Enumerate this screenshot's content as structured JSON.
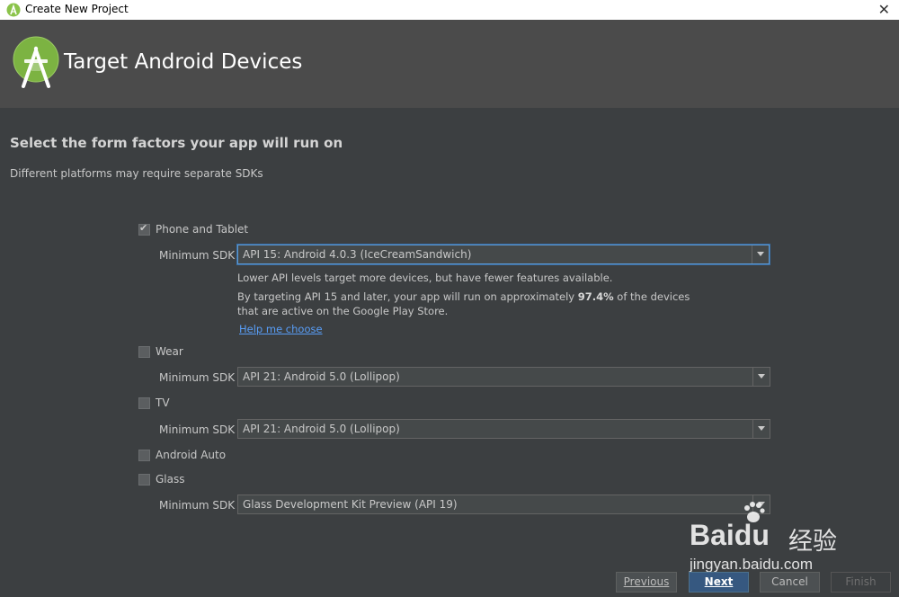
{
  "window": {
    "title": "Create New Project",
    "close_glyph": "✕"
  },
  "banner": {
    "heading": "Target Android Devices"
  },
  "page": {
    "heading": "Select the form factors your app will run on",
    "subtext": "Different platforms may require separate SDKs"
  },
  "form": {
    "min_sdk_label": "Minimum SDK",
    "phone": {
      "label": "Phone and Tablet",
      "checked": true,
      "sdk": "API 15: Android 4.0.3 (IceCreamSandwich)",
      "info1": "Lower API levels target more devices, but have fewer features available.",
      "info2_pre": "By targeting API 15 and later, your app will run on approximately ",
      "info2_bold": "97.4%",
      "info2_post": " of the devices",
      "info3": "that are active on the Google Play Store.",
      "help_link": "Help me choose"
    },
    "wear": {
      "label": "Wear",
      "checked": false,
      "sdk": "API 21: Android 5.0 (Lollipop)"
    },
    "tv": {
      "label": "TV",
      "checked": false,
      "sdk": "API 21: Android 5.0 (Lollipop)"
    },
    "auto": {
      "label": "Android Auto",
      "checked": false
    },
    "glass": {
      "label": "Glass",
      "checked": false,
      "sdk": "Glass Development Kit Preview (API 19)"
    }
  },
  "buttons": {
    "previous": "Previous",
    "next": "Next",
    "cancel": "Cancel",
    "finish": "Finish"
  },
  "watermark": {
    "brand_a": "Bai",
    "brand_b": "du",
    "brand_cn": "经验",
    "url": "jingyan.baidu.com"
  },
  "colors": {
    "accent": "#365880",
    "link": "#589df6",
    "android_green": "#8bc34a"
  },
  "icons": {
    "app": "android-studio-icon",
    "logo": "android-studio-logo",
    "close": "close-icon",
    "dropdown": "chevron-down-icon",
    "checkbox": "checkbox-icon"
  }
}
